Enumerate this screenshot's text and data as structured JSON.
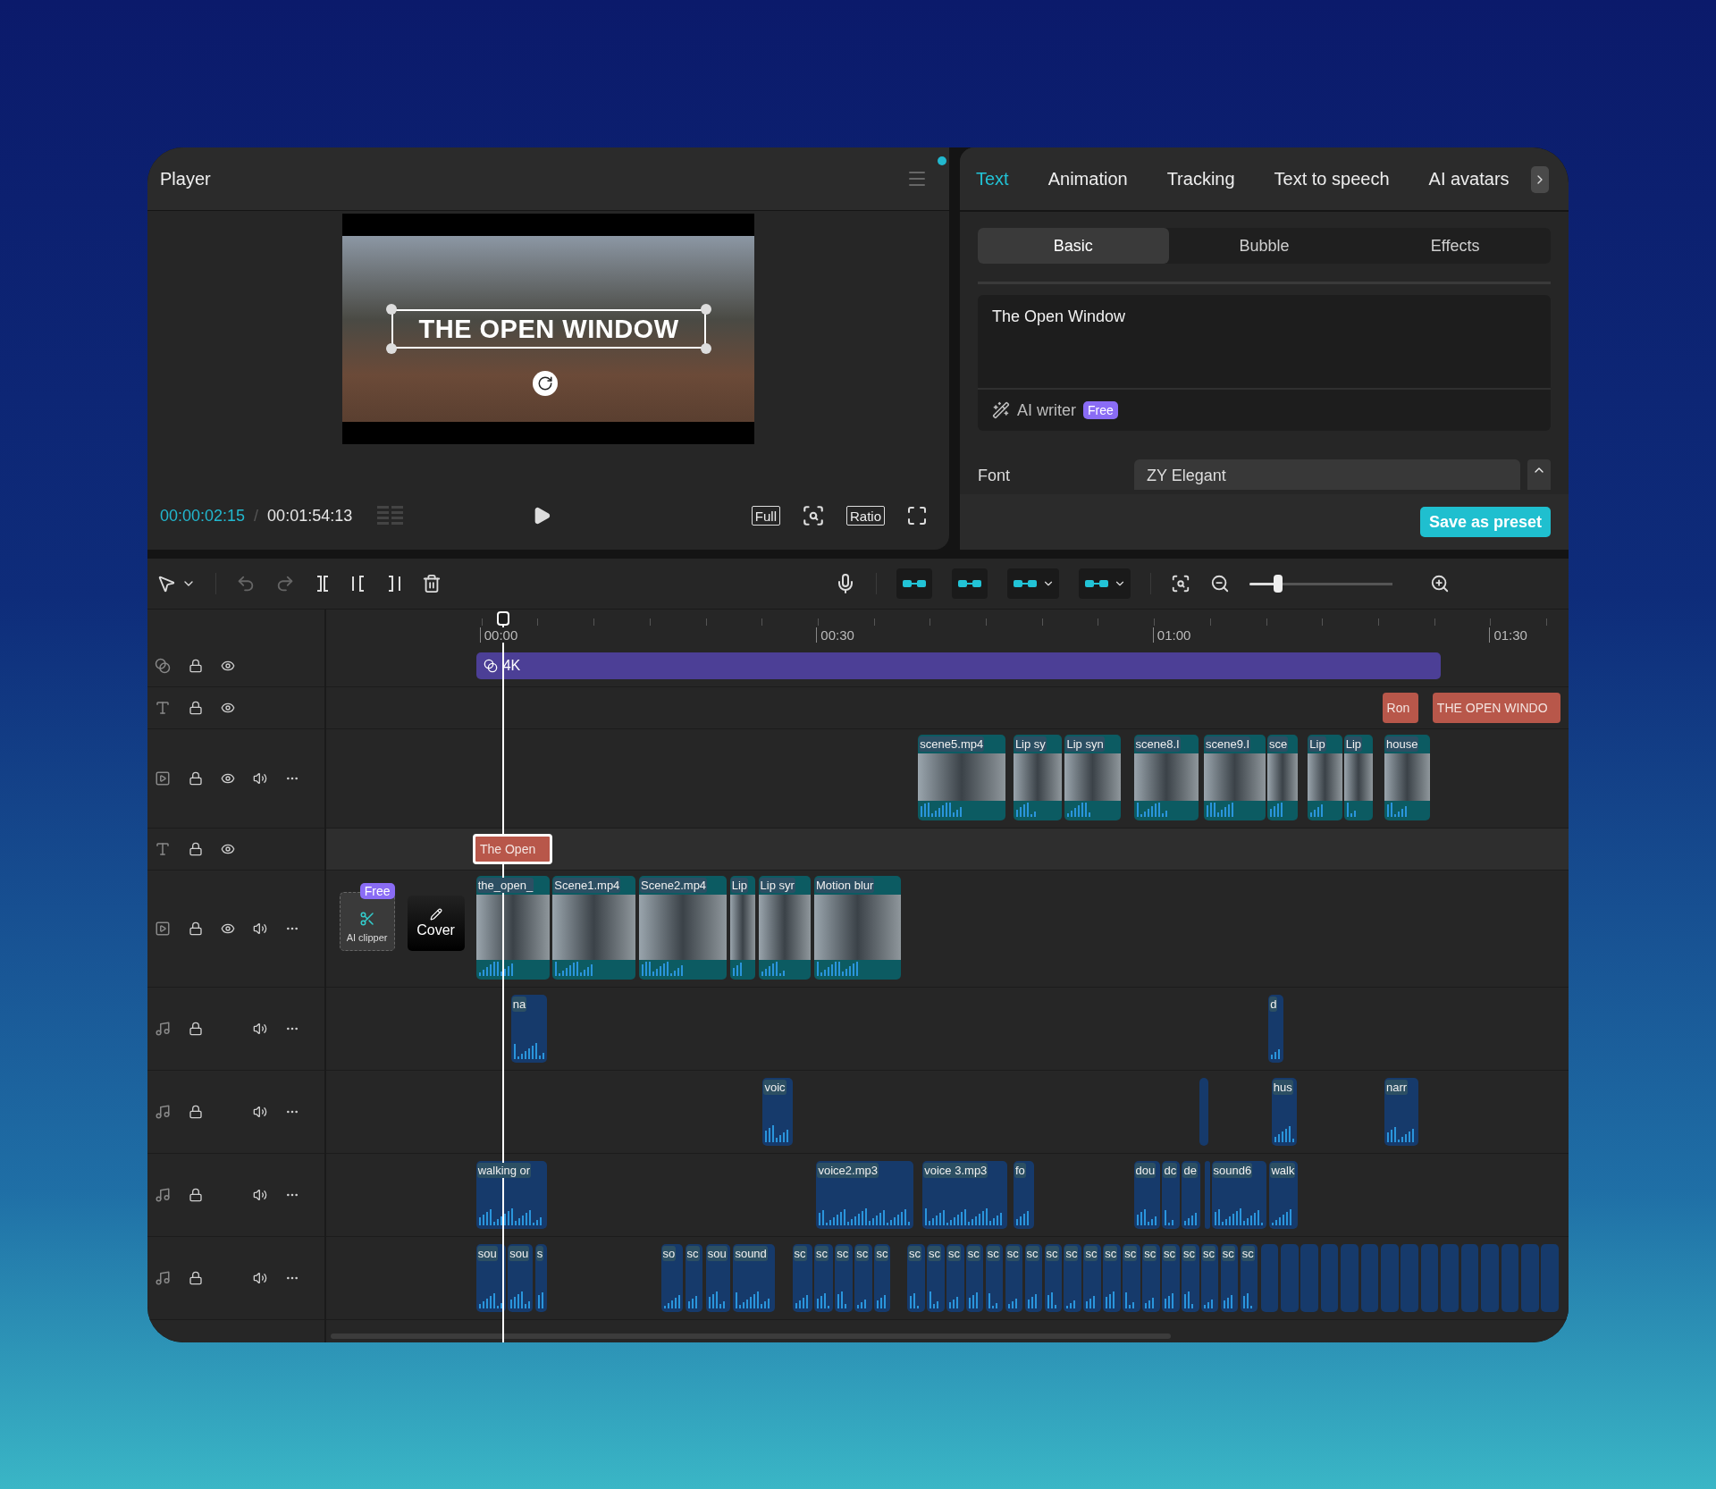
{
  "player": {
    "title": "Player",
    "preview": {
      "overlay_text": "THE OPEN WINDOW"
    },
    "current_time": "00:00:02:15",
    "separator": "/",
    "duration": "00:01:54:13",
    "buttons": [
      "Full",
      "Ratio"
    ]
  },
  "panel": {
    "tabs": [
      {
        "label": "Text",
        "selected": true
      },
      {
        "label": "Animation",
        "selected": false
      },
      {
        "label": "Tracking",
        "selected": false
      },
      {
        "label": "Text to speech",
        "selected": false
      },
      {
        "label": "AI avatars",
        "selected": false
      }
    ],
    "subtabs": [
      {
        "label": "Basic",
        "selected": true
      },
      {
        "label": "Bubble",
        "selected": false
      },
      {
        "label": "Effects",
        "selected": false
      }
    ],
    "text_value": "The Open Window",
    "ai_writer": {
      "label": "AI writer",
      "badge": "Free"
    },
    "font": {
      "label": "Font",
      "value": "ZY Elegant"
    },
    "save_button": "Save as preset"
  },
  "toolbar": {
    "toggles": [
      {
        "on": true
      },
      {
        "on": true
      },
      {
        "on": true
      },
      {
        "on": true
      }
    ],
    "zoom": {
      "level": 0.2
    }
  },
  "ruler": [
    "00:00",
    "00:30",
    "01:00",
    "01:30"
  ],
  "main_track_tools": {
    "clipper_label": "AI clipper",
    "badge": "Free",
    "cover_label": "Cover"
  },
  "tracks": [
    {
      "kind": "effect",
      "clips": [
        {
          "label": "4K"
        }
      ]
    },
    {
      "kind": "text",
      "clips": [
        {
          "label": "Ron",
          "selected": false
        },
        {
          "label": "THE OPEN WINDO",
          "selected": false
        }
      ]
    },
    {
      "kind": "video",
      "clips": [
        {
          "label": "scene5.mp4"
        },
        {
          "label": "Lip sy"
        },
        {
          "label": "Lip syn"
        },
        {
          "label": "scene8.I"
        },
        {
          "label": "scene9.I"
        },
        {
          "label": "sce"
        },
        {
          "label": "Lip"
        },
        {
          "label": "Lip"
        },
        {
          "label": "house"
        }
      ]
    },
    {
      "kind": "text",
      "clips": [
        {
          "label": "The Open",
          "selected": true
        }
      ]
    },
    {
      "kind": "main",
      "clips": [
        {
          "label": "the_open_"
        },
        {
          "label": "Scene1.mp4"
        },
        {
          "label": "Scene2.mp4"
        },
        {
          "label": "Lip"
        },
        {
          "label": "Lip syr"
        },
        {
          "label": "Motion blur"
        }
      ]
    },
    {
      "kind": "audio",
      "clips": [
        {
          "label": "na"
        },
        {
          "label": "d"
        }
      ]
    },
    {
      "kind": "audio",
      "clips": [
        {
          "label": "voic"
        },
        {
          "kind": "empty"
        },
        {
          "label": "hus"
        },
        {
          "label": "narr"
        }
      ]
    },
    {
      "kind": "audio",
      "clips": [
        {
          "label": "walking or"
        },
        {
          "label": "voice2.mp3"
        },
        {
          "label": "voice 3.mp3"
        },
        {
          "label": "fo"
        },
        {
          "label": "dou"
        },
        {
          "label": "dc"
        },
        {
          "label": "de"
        },
        {
          "kind": "empty"
        },
        {
          "label": "sound6"
        },
        {
          "label": "walk"
        }
      ]
    },
    {
      "kind": "audio",
      "clips": [
        {
          "label": "sou"
        },
        {
          "label": "sou"
        },
        {
          "label": "s"
        },
        {
          "label": "so"
        },
        {
          "label": "sc"
        },
        {
          "label": "sou"
        },
        {
          "label": "sound"
        },
        {
          "label": "sc"
        },
        {
          "label": "sc"
        },
        {
          "label": "sc"
        },
        {
          "label": "sc"
        },
        {
          "label": "sc"
        },
        {
          "label": "sc"
        },
        {
          "label": "sc"
        },
        {
          "label": "sc"
        },
        {
          "label": "sc"
        },
        {
          "label": "sc"
        },
        {
          "label": "sc"
        },
        {
          "label": "sc"
        },
        {
          "label": "sc"
        },
        {
          "label": "sc"
        },
        {
          "label": "sc"
        },
        {
          "label": "sc"
        },
        {
          "label": "sc"
        },
        {
          "label": "sc"
        },
        {
          "label": "sc"
        },
        {
          "label": "sc"
        },
        {
          "label": "sc"
        },
        {
          "label": "sc"
        },
        {
          "label": "sc"
        },
        {
          "kind": "empty"
        },
        {
          "kind": "empty"
        },
        {
          "kind": "empty"
        },
        {
          "kind": "empty"
        },
        {
          "kind": "empty"
        },
        {
          "kind": "empty"
        },
        {
          "kind": "empty"
        },
        {
          "kind": "empty"
        },
        {
          "kind": "empty"
        },
        {
          "kind": "empty"
        },
        {
          "kind": "empty"
        },
        {
          "kind": "empty"
        },
        {
          "kind": "empty"
        },
        {
          "kind": "empty"
        },
        {
          "kind": "empty"
        }
      ]
    }
  ]
}
